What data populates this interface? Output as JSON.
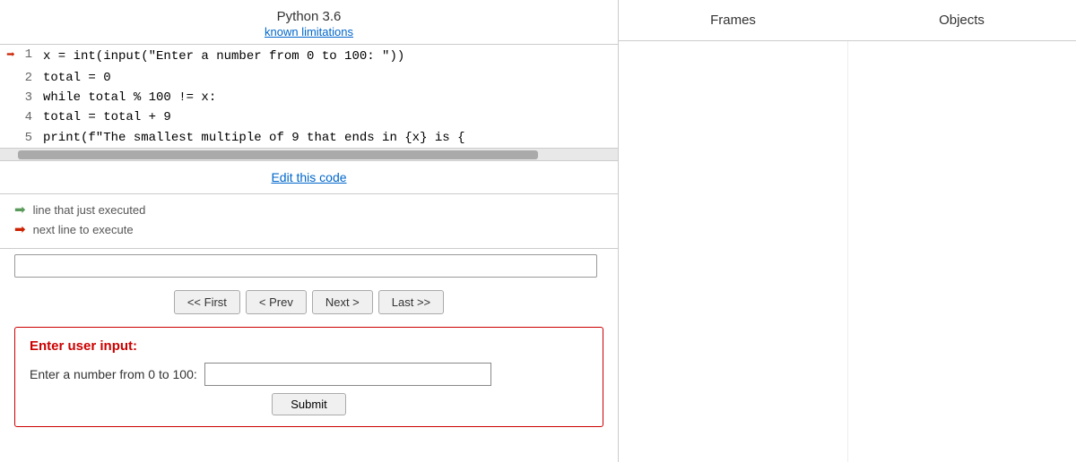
{
  "header": {
    "title": "Python 3.6",
    "link_text": "known limitations"
  },
  "code": {
    "lines": [
      {
        "num": 1,
        "arrow": "red",
        "code": "x = int(input(\"Enter a number from 0 to 100: \"))"
      },
      {
        "num": 2,
        "arrow": "",
        "code": "total = 0"
      },
      {
        "num": 3,
        "arrow": "",
        "code": "while total % 100 != x:"
      },
      {
        "num": 4,
        "arrow": "",
        "code": "    total = total + 9"
      },
      {
        "num": 5,
        "arrow": "",
        "code": "print(f\"The smallest multiple of 9 that ends in {x} is {"
      }
    ]
  },
  "edit_link": "Edit this code",
  "legend": {
    "green_label": "line that just executed",
    "red_label": "next line to execute"
  },
  "nav_buttons": {
    "first": "<< First",
    "prev": "< Prev",
    "next": "Next >",
    "last": "Last >>"
  },
  "user_input": {
    "label": "Enter user input:",
    "prompt": "Enter a number from 0 to 100:",
    "submit": "Submit",
    "field_value": ""
  },
  "right_panel": {
    "tabs": [
      "Frames",
      "Objects"
    ]
  }
}
